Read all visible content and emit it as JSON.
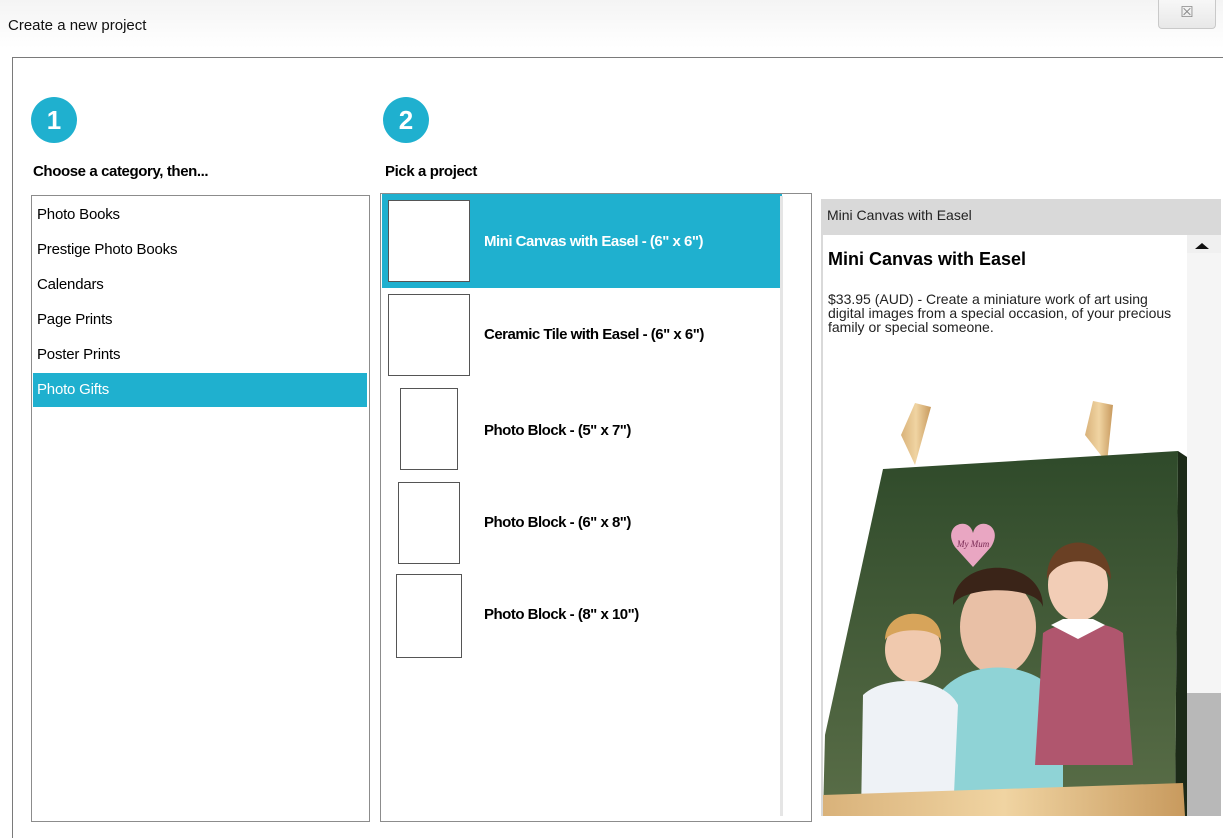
{
  "window": {
    "title": "Create a new project",
    "close_glyph": "☒"
  },
  "steps": [
    {
      "number": "1",
      "label": "Choose a category, then..."
    },
    {
      "number": "2",
      "label": "Pick a project"
    }
  ],
  "categories": [
    {
      "label": "Photo Books",
      "selected": false
    },
    {
      "label": "Prestige Photo Books",
      "selected": false
    },
    {
      "label": "Calendars",
      "selected": false
    },
    {
      "label": "Page Prints",
      "selected": false
    },
    {
      "label": "Poster Prints",
      "selected": false
    },
    {
      "label": "Photo Gifts",
      "selected": true
    }
  ],
  "projects": [
    {
      "label": "Mini Canvas with Easel - (6\" x 6\")",
      "selected": true
    },
    {
      "label": "Ceramic Tile with Easel - (6\" x 6\")",
      "selected": false
    },
    {
      "label": "Photo Block - (5\" x 7\")",
      "selected": false
    },
    {
      "label": "Photo Block - (6\" x 8\")",
      "selected": false
    },
    {
      "label": "Photo Block - (8\" x 10\")",
      "selected": false
    }
  ],
  "detail": {
    "header": "Mini Canvas with Easel",
    "title": "Mini Canvas with Easel",
    "description": "$33.95 (AUD) - Create a miniature work of art using digital images from a special occasion, of your precious family or special someone.",
    "image_caption_text": "My Mum"
  },
  "colors": {
    "accent": "#1fb0cf",
    "panel_gray": "#d9d9d9"
  }
}
